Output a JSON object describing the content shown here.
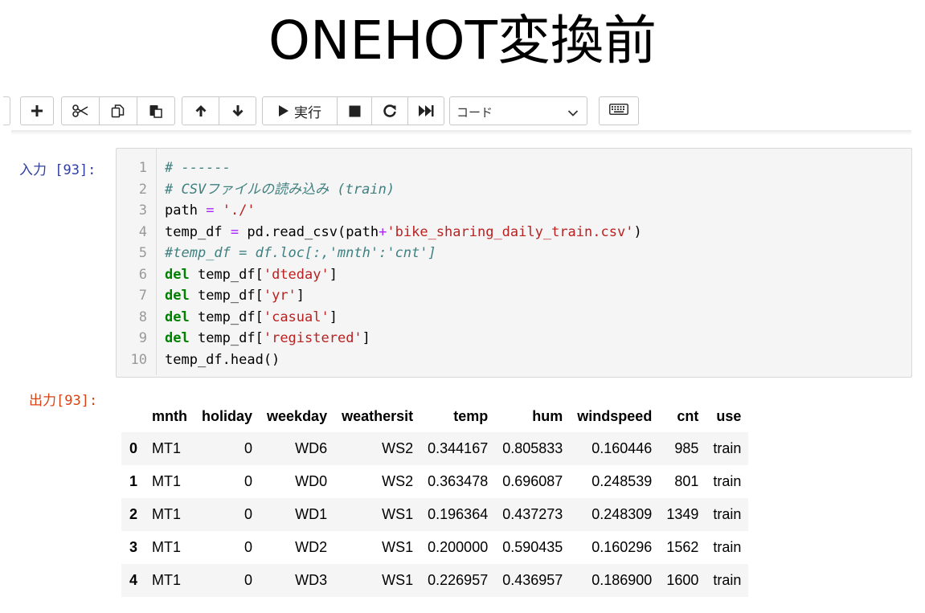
{
  "title": "ONEHOT変換前",
  "toolbar": {
    "run_label": "実行",
    "cell_type": "コード",
    "icons": [
      "plus-icon",
      "scissors-icon",
      "copy-icon",
      "paste-icon",
      "arrow-up-icon",
      "arrow-down-icon",
      "play-icon",
      "stop-icon",
      "restart-icon",
      "fast-forward-icon",
      "chevron-down-icon",
      "keyboard-icon"
    ]
  },
  "input_cell": {
    "prompt_prefix": "入力",
    "prompt_num": " [93]:",
    "line_numbers": [
      "1",
      "2",
      "3",
      "4",
      "5",
      "6",
      "7",
      "8",
      "9",
      "10"
    ],
    "code": {
      "l1": "# ------",
      "l2": "# CSVファイルの読み込み (train)",
      "l3_a": "path ",
      "l3_op": "=",
      "l3_b": " ",
      "l3_s": "'./'",
      "l4_a": "temp_df ",
      "l4_op": "=",
      "l4_b": " pd.read_csv(path",
      "l4_op2": "+",
      "l4_s": "'bike_sharing_daily_train.csv'",
      "l4_c": ")",
      "l5": "#temp_df = df.loc[:,'mnth':'cnt']",
      "l6_k": "del",
      "l6_a": " temp_df[",
      "l6_s": "'dteday'",
      "l6_c": "]",
      "l7_k": "del",
      "l7_a": " temp_df[",
      "l7_s": "'yr'",
      "l7_c": "]",
      "l8_k": "del",
      "l8_a": " temp_df[",
      "l8_s": "'casual'",
      "l8_c": "]",
      "l9_k": "del",
      "l9_a": " temp_df[",
      "l9_s": "'registered'",
      "l9_c": "]",
      "l10": "temp_df.head()"
    }
  },
  "output_cell": {
    "prompt_prefix": "出力",
    "prompt_num": "[93]:",
    "columns": [
      "mnth",
      "holiday",
      "weekday",
      "weathersit",
      "temp",
      "hum",
      "windspeed",
      "cnt",
      "use"
    ],
    "rows": [
      {
        "idx": "0",
        "c": [
          "MT1",
          "0",
          "WD6",
          "WS2",
          "0.344167",
          "0.805833",
          "0.160446",
          "985",
          "train"
        ]
      },
      {
        "idx": "1",
        "c": [
          "MT1",
          "0",
          "WD0",
          "WS2",
          "0.363478",
          "0.696087",
          "0.248539",
          "801",
          "train"
        ]
      },
      {
        "idx": "2",
        "c": [
          "MT1",
          "0",
          "WD1",
          "WS1",
          "0.196364",
          "0.437273",
          "0.248309",
          "1349",
          "train"
        ]
      },
      {
        "idx": "3",
        "c": [
          "MT1",
          "0",
          "WD2",
          "WS1",
          "0.200000",
          "0.590435",
          "0.160296",
          "1562",
          "train"
        ]
      },
      {
        "idx": "4",
        "c": [
          "MT1",
          "0",
          "WD3",
          "WS1",
          "0.226957",
          "0.436957",
          "0.186900",
          "1600",
          "train"
        ]
      }
    ]
  }
}
